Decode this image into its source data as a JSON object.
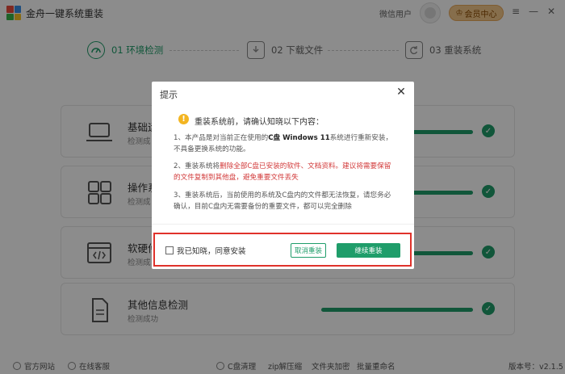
{
  "app": {
    "title": "金舟一键系统重装",
    "user_name": "微信用户",
    "member_label": "会员中心",
    "logo_colors": [
      "#e94b3c",
      "#3a8ee6",
      "#39b54a",
      "#f7c325"
    ]
  },
  "window_controls": [
    "≡",
    "—",
    "✕"
  ],
  "steps": [
    {
      "label": "01 环境检测",
      "icon": "gauge-icon",
      "active": true
    },
    {
      "label": "02 下载文件",
      "icon": "download-file-icon",
      "active": false
    },
    {
      "label": "03 重装系统",
      "icon": "refresh-screen-icon",
      "active": false
    }
  ],
  "cards": [
    {
      "title": "基础运",
      "subtitle": "检测成",
      "icon": "laptop-icon"
    },
    {
      "title": "操作系",
      "subtitle": "检测成",
      "icon": "grid-icon"
    },
    {
      "title": "软硬件",
      "subtitle": "检测成",
      "icon": "code-window-icon"
    },
    {
      "title": "其他信息检测",
      "subtitle": "检测成功",
      "icon": "document-icon"
    }
  ],
  "footer": {
    "items": [
      {
        "label": "官方网站",
        "icon": "globe-icon"
      },
      {
        "label": "在线客服",
        "icon": "headset-icon"
      },
      {
        "label": "C盘清理",
        "icon": "broom-icon"
      },
      {
        "label": "zip解压缩",
        "icon": "zip-icon"
      },
      {
        "label": "文件夹加密",
        "icon": "folder-lock-icon"
      },
      {
        "label": "批量重命名",
        "icon": "rename-icon"
      }
    ],
    "version": "版本号：v2.1.5"
  },
  "dialog": {
    "title": "提示",
    "close": "✕",
    "heading": "重装系统前，请确认知晓以下内容：",
    "p1_a": "1、本产品是对当前正在使用的",
    "p1_bold": "C盘 Windows 11",
    "p1_b": "系统进行重新安装，不具备更换系统的功能。",
    "p2_a": "2、重装系统将",
    "p2_red": "删除全部C盘已安装的软件、文档资料。建议将需要保留的文件复制到其他盘，避免重要文件丢失",
    "p3": "3、重装系统后，当前使用的系统及C盘内的文件都无法恢复，请您务必确认，目前C盘内无需要备份的重要文件，都可以完全删除",
    "agree_label": "我已知晓，同意安装",
    "cancel_label": "取消重装",
    "continue_label": "继续重装"
  },
  "colors": {
    "accent": "#1f9d6a",
    "warning": "#f3b521",
    "danger_text": "#d23a3a",
    "highlight": "#e0322b"
  }
}
